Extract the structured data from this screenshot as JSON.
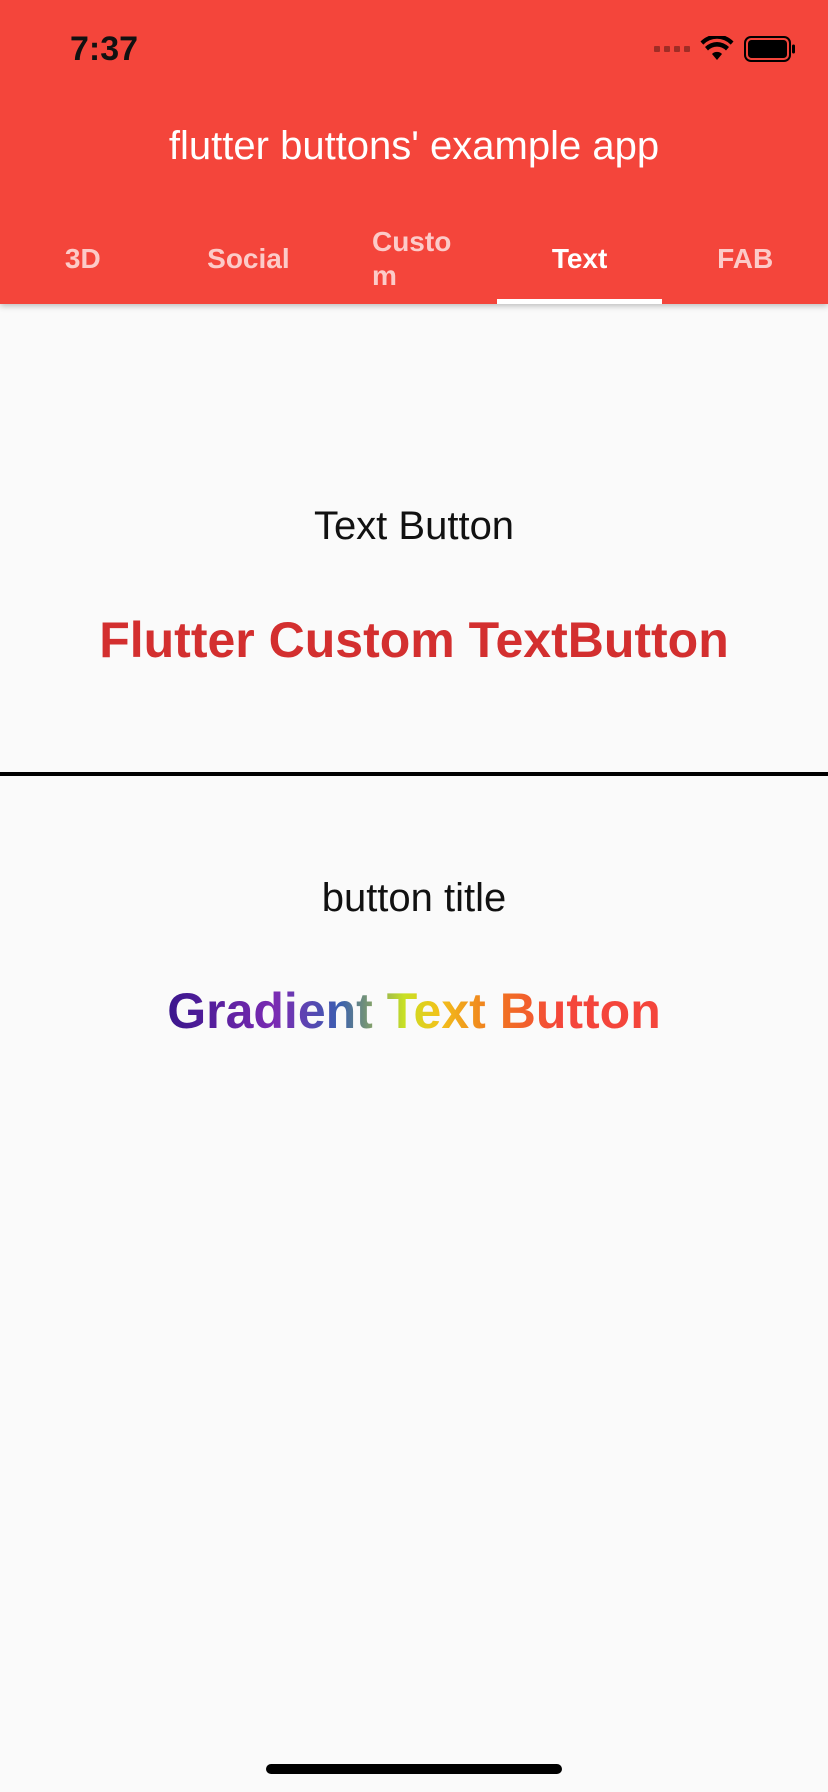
{
  "status_bar": {
    "time": "7:37",
    "icons": [
      "signal-icon",
      "wifi-icon",
      "battery-icon"
    ]
  },
  "app_bar": {
    "title": "flutter buttons' example app",
    "background_color": "#f4453b"
  },
  "tabs": [
    {
      "label": "3D",
      "active": false
    },
    {
      "label": "Social",
      "active": false
    },
    {
      "label": "Custom",
      "active": false
    },
    {
      "label": "Text",
      "active": true
    },
    {
      "label": "FAB",
      "active": false
    }
  ],
  "sections": {
    "text_button": {
      "title": "Text Button",
      "button_label": "Flutter Custom TextButton",
      "button_color": "#d32f2f"
    },
    "gradient_button": {
      "title": "button title",
      "button_label": "Gradient Text Button",
      "gradient_colors": [
        "#3a168c",
        "#7b2bb3",
        "#3a5fb0",
        "#c8e024",
        "#f2c21a",
        "#f0781f",
        "#f4453b"
      ]
    }
  }
}
